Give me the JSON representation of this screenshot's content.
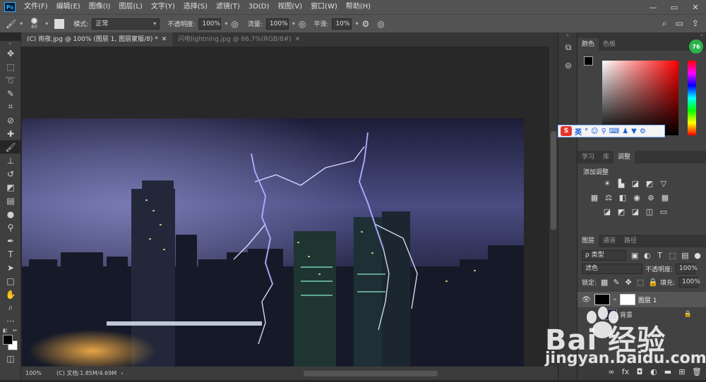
{
  "app": {
    "logo": "Ps",
    "menu": [
      "文件(F)",
      "编辑(E)",
      "图像(I)",
      "图层(L)",
      "文字(Y)",
      "选择(S)",
      "滤镜(T)",
      "3D(D)",
      "视图(V)",
      "窗口(W)",
      "帮助(H)"
    ],
    "window_controls": [
      "—",
      "▭",
      "✕"
    ]
  },
  "options": {
    "brush_size": "40",
    "mode_label": "模式:",
    "mode_value": "正常",
    "opacity_label": "不透明度:",
    "opacity_value": "100%",
    "flow_label": "流量:",
    "flow_value": "100%",
    "smooth_label": "平滑:",
    "smooth_value": "10%"
  },
  "tabs": [
    {
      "label": "(C) 雨夜.jpg @ 100% (图层 1, 图层蒙版/8) *",
      "close": "✕"
    },
    {
      "label": "闪电lightning.jpg @ 66.7%(RGB/8#)",
      "close": "✕"
    }
  ],
  "status": {
    "zoom": "100%",
    "doc": "(C) 文档:1.85M/4.69M",
    "arrow": "›"
  },
  "color_panel": {
    "tabs": [
      "颜色",
      "色板"
    ],
    "badge": "76"
  },
  "ime": {
    "label": "英"
  },
  "adjust_panel": {
    "tabs": [
      "学习",
      "库",
      "调整"
    ],
    "heading": "添加调整"
  },
  "layers_panel": {
    "tabs": [
      "图层",
      "通道",
      "路径"
    ],
    "filter": "ρ 类型",
    "blend": "滤色",
    "opacity_label": "不透明度:",
    "opacity_value": "100%",
    "lock_label": "锁定:",
    "fill_label": "填充:",
    "fill_value": "100%",
    "layers": [
      {
        "name": "图层 1"
      },
      {
        "name": "背景"
      }
    ]
  },
  "watermark": {
    "text": "Bai 经验",
    "url": "jingyan.baidu.com"
  }
}
